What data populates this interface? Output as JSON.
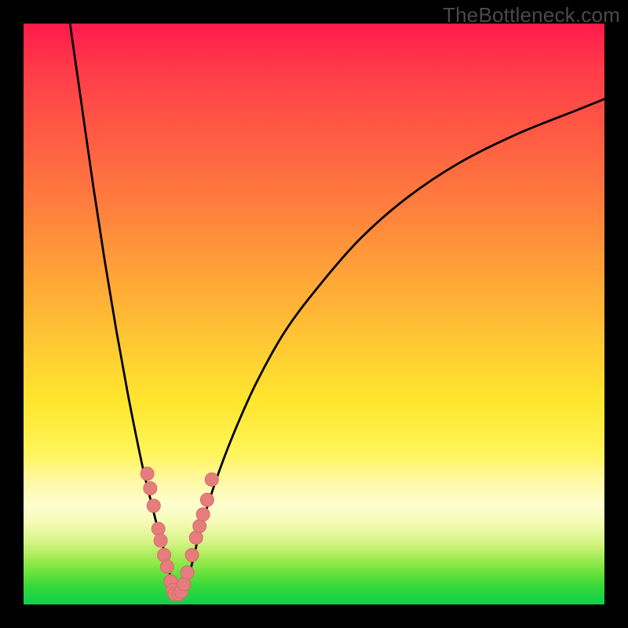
{
  "watermark": "TheBottleneck.com",
  "colors": {
    "frame": "#000000",
    "curve": "#000000",
    "marker_fill": "#e67d7d",
    "marker_stroke": "#d86a6a"
  },
  "chart_data": {
    "type": "line",
    "title": "",
    "xlabel": "",
    "ylabel": "",
    "xlim": [
      0,
      100
    ],
    "ylim": [
      0,
      100
    ],
    "grid": false,
    "series": [
      {
        "name": "left-branch",
        "x": [
          8,
          10,
          12,
          14,
          16,
          18,
          20,
          21,
          22,
          23,
          24,
          25,
          25.8
        ],
        "y": [
          100,
          86,
          72,
          59,
          47,
          36,
          26,
          21.5,
          17.5,
          13.5,
          10,
          6,
          2
        ]
      },
      {
        "name": "right-branch",
        "x": [
          27.7,
          29,
          30.5,
          33,
          36,
          40,
          45,
          51,
          58,
          66,
          75,
          85,
          95,
          100
        ],
        "y": [
          2,
          7,
          13,
          21,
          29,
          38,
          47,
          55,
          63,
          70,
          76,
          81,
          85,
          87
        ]
      },
      {
        "name": "data-points",
        "plot_as": "scatter",
        "x": [
          21.3,
          21.8,
          22.4,
          23.2,
          23.6,
          24.2,
          24.7,
          25.3,
          25.7,
          26.0,
          26.7,
          27.1,
          27.6,
          28.2,
          29.0,
          29.7,
          30.3,
          30.9,
          31.6,
          32.4
        ],
        "y": [
          22.5,
          20.0,
          17.0,
          13.0,
          11.0,
          8.5,
          6.5,
          4.0,
          2.5,
          1.8,
          1.8,
          2.2,
          3.5,
          5.5,
          8.5,
          11.5,
          13.5,
          15.5,
          18.0,
          21.5
        ]
      }
    ]
  }
}
